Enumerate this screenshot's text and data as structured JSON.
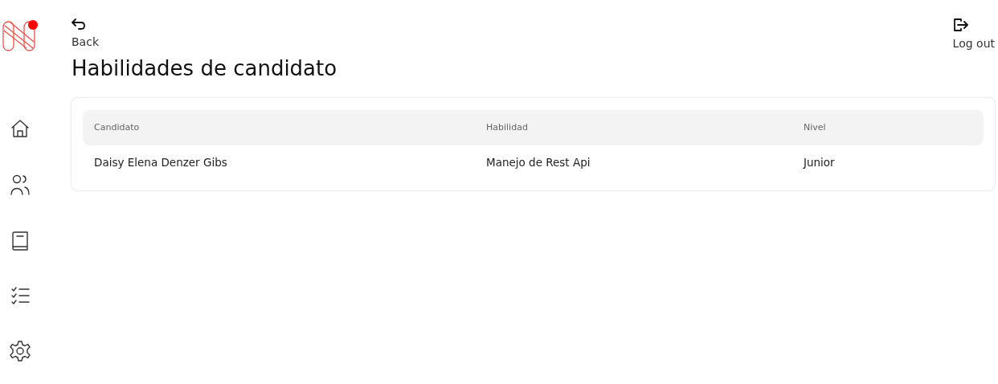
{
  "header": {
    "back_label": "Back",
    "logout_label": "Log out"
  },
  "page_title": "Habilidades de candidato",
  "table": {
    "columns": [
      "Candidato",
      "Habilidad",
      "Nivel"
    ],
    "rows": [
      [
        "Daisy Elena Denzer Gibs",
        "Manejo de Rest Api",
        "Junior"
      ]
    ]
  }
}
